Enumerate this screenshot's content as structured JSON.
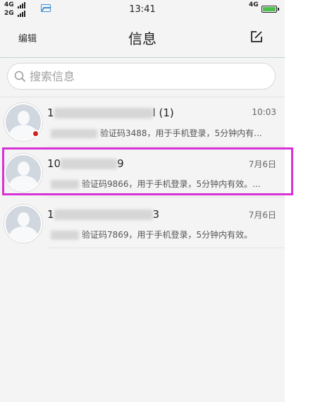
{
  "status_bar": {
    "sim1_network": "4G",
    "sim2_network": "2G",
    "time": "13:41",
    "data_network": "4G"
  },
  "header": {
    "edit_label": "编辑",
    "title": "信息"
  },
  "search": {
    "placeholder": "搜索信息"
  },
  "conversations": [
    {
      "name_prefix": "1",
      "name_suffix": "l (1)",
      "time": "10:03",
      "preview": "验证码3488，用于手机登录，5分钟内有...",
      "unread": true
    },
    {
      "name_prefix": "10",
      "name_suffix": "9",
      "time": "7月6日",
      "preview": "验证码9866，用于手机登录，5分钟内有效。...",
      "unread": false
    },
    {
      "name_prefix": "1",
      "name_suffix": "3",
      "time": "7月6日",
      "preview": "验证码7869，用于手机登录，5分钟内有效。",
      "unread": false
    }
  ],
  "colors": {
    "highlight": "#d632d6",
    "unread_dot": "#d21f1f",
    "battery": "#4cc24c"
  }
}
